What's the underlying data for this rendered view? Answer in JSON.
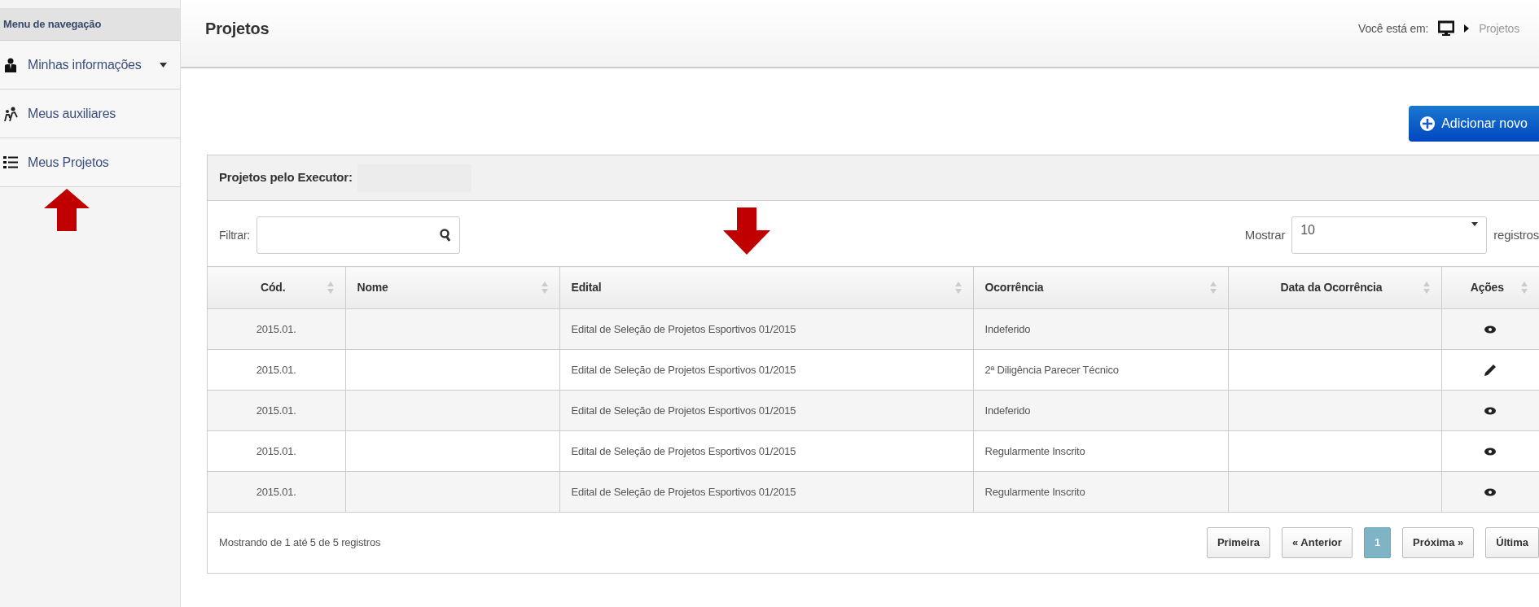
{
  "sidebar": {
    "title": "Menu de navegação",
    "items": [
      {
        "label": "Minhas informações",
        "kind": "user",
        "has_submenu": true
      },
      {
        "label": "Meus auxiliares",
        "kind": "people",
        "has_submenu": false
      },
      {
        "label": "Meus Projetos",
        "kind": "list",
        "has_submenu": false
      }
    ]
  },
  "page": {
    "title": "Projetos",
    "breadcrumb": {
      "prefix": "Você está em:",
      "current": "Projetos"
    }
  },
  "add_button": "Adicionar novo",
  "panel": {
    "title": "Projetos pelo Executor:",
    "filter": {
      "label": "Filtrar:"
    },
    "page_size": {
      "label": "Mostrar",
      "value": "10",
      "suffix": "registros"
    },
    "table": {
      "columns": [
        "Cód.",
        "Nome",
        "Edital",
        "Ocorrência",
        "Data da Ocorrência",
        "Ações"
      ],
      "rows": [
        {
          "code": "2015.01.",
          "edital": "Edital de Seleção de Projetos Esportivos 01/2015",
          "ocorrencia": "Indeferido",
          "kind": "view"
        },
        {
          "code": "2015.01.",
          "edital": "Edital de Seleção de Projetos Esportivos 01/2015",
          "ocorrencia": "2ª Diligência Parecer Técnico",
          "kind": "edit"
        },
        {
          "code": "2015.01.",
          "edital": "Edital de Seleção de Projetos Esportivos 01/2015",
          "ocorrencia": "Indeferido",
          "kind": "view"
        },
        {
          "code": "2015.01.",
          "edital": "Edital de Seleção de Projetos Esportivos 01/2015",
          "ocorrencia": "Regularmente Inscrito",
          "kind": "view"
        },
        {
          "code": "2015.01.",
          "edital": "Edital de Seleção de Projetos Esportivos 01/2015",
          "ocorrencia": "Regularmente Inscrito",
          "kind": "view"
        }
      ]
    },
    "info": "Mostrando de 1 até 5 de 5 registros",
    "pagination": [
      {
        "label": "Primeira",
        "selected": false
      },
      {
        "label": "« Anterior",
        "selected": false
      },
      {
        "label": "1",
        "selected": true
      },
      {
        "label": "Próxima »",
        "selected": false
      },
      {
        "label": "Última",
        "selected": false
      }
    ]
  }
}
